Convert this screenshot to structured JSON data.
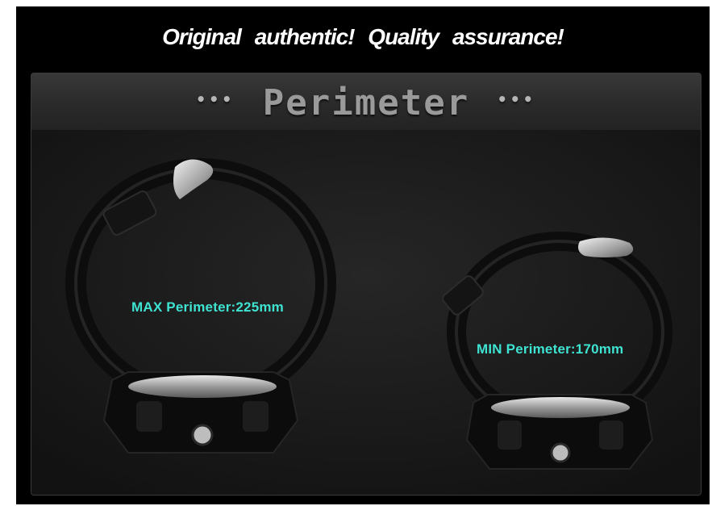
{
  "headline": "Original authentic!  Quality assurance!",
  "panel": {
    "title": "Perimeter",
    "title_decor": "•••"
  },
  "labels": {
    "max": "MAX Perimeter:225mm",
    "min": "MIN Perimeter:170mm"
  },
  "colors": {
    "label_accent": "#3fe3d2",
    "background": "#000000",
    "panel": "#1c1c1c"
  }
}
